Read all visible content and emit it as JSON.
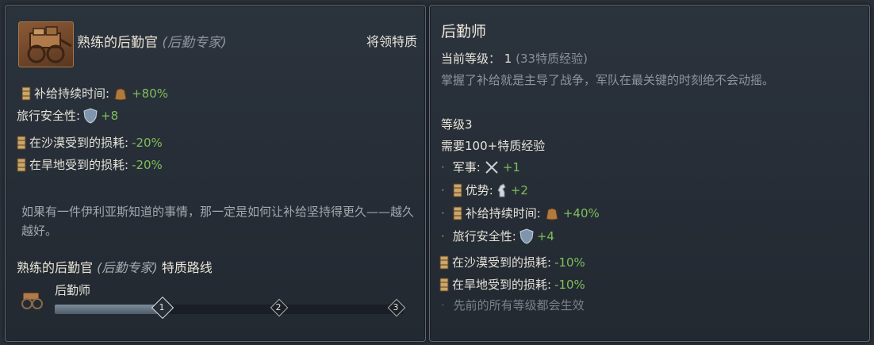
{
  "left": {
    "title": "熟练的后勤官",
    "title_paren": "(后勤专家)",
    "category": "将领特质",
    "modifiers": [
      {
        "label": "补给持续时间:",
        "value": "+80%",
        "lead_icon": "supply-crate-icon",
        "value_icon": "supply-bag-icon"
      },
      {
        "label": "旅行安全性:",
        "value": "+8",
        "lead_icon": "",
        "value_icon": "shield-icon"
      },
      {
        "label": "在沙漠受到的损耗:",
        "value": "-20%",
        "lead_icon": "supply-crate-icon",
        "value_icon": ""
      },
      {
        "label": "在旱地受到的损耗:",
        "value": "-20%",
        "lead_icon": "supply-crate-icon",
        "value_icon": ""
      }
    ],
    "flavor": "如果有一件伊利亚斯知道的事情，那一定是如何让补给坚持得更久——越久越好。",
    "route_title": "熟练的后勤官",
    "route_paren": "(后勤专家)",
    "route_suffix": "特质路线",
    "track_label": "后勤师",
    "nodes": [
      "1",
      "2",
      "3"
    ],
    "progress_fraction": 0.31
  },
  "right": {
    "title": "后勤师",
    "level_label": "当前等级：",
    "level_value": "1",
    "level_xp": "(33特质经验)",
    "description": "掌握了补给就是主导了战争，军队在最关键的时刻绝不会动摇。",
    "next_level": "等级3",
    "requirement": "需要100+特质经验",
    "bullets": [
      {
        "label": "军事:",
        "value": "+1",
        "lead_icon": "",
        "value_icon": "crossed-swords-icon"
      },
      {
        "label": "优势:",
        "value": "+2",
        "lead_icon": "supply-crate-icon",
        "value_icon": "chess-knight-icon"
      },
      {
        "label": "补给持续时间:",
        "value": "+40%",
        "lead_icon": "supply-crate-icon",
        "value_icon": "supply-bag-icon"
      },
      {
        "label": "旅行安全性:",
        "value": "+4",
        "lead_icon": "",
        "value_icon": "shield-icon"
      }
    ],
    "extra": [
      {
        "label": "在沙漠受到的损耗:",
        "value": "-10%"
      },
      {
        "label": "在旱地受到的损耗:",
        "value": "-10%"
      }
    ],
    "footer": "先前的所有等级都会生效"
  },
  "colors": {
    "positive": "#7fbf5a",
    "muted": "#8f959c",
    "text": "#e6e2d8"
  }
}
